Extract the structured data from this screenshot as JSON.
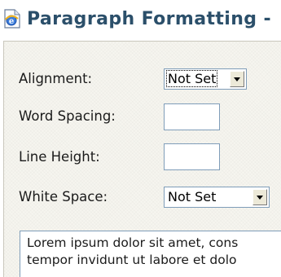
{
  "window": {
    "title": "Paragraph Formatting -",
    "icon": "ie-page-icon"
  },
  "form": {
    "alignment": {
      "label": "Alignment:",
      "value": "Not Set"
    },
    "word_spacing": {
      "label": "Word Spacing:",
      "value": ""
    },
    "line_height": {
      "label": "Line Height:",
      "value": ""
    },
    "white_space": {
      "label": "White Space:",
      "value": "Not Set"
    }
  },
  "preview": {
    "line1": "Lorem ipsum dolor sit amet, cons",
    "line2": "tempor invidunt ut labore et dolo"
  },
  "colors": {
    "title_text": "#2b4f6a",
    "panel_bg": "#f6f5ef",
    "control_border": "#7f9db9",
    "button_face": "#ece9d8"
  }
}
